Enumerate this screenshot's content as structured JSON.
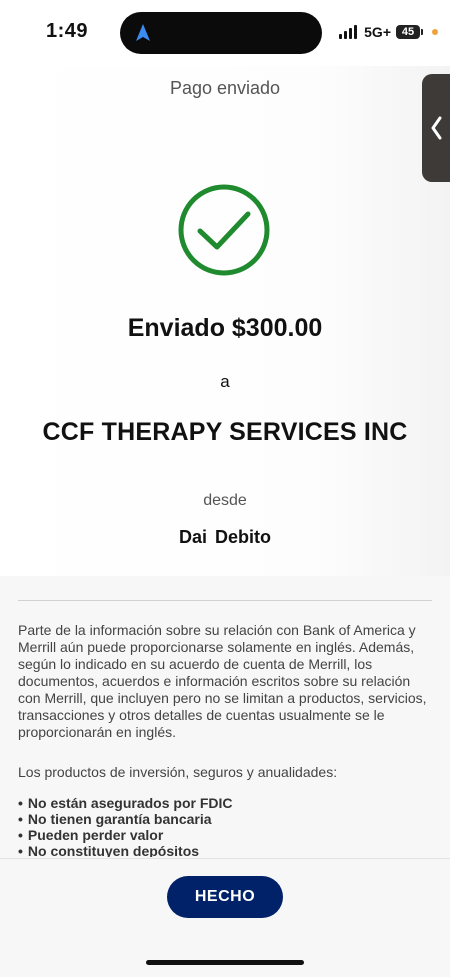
{
  "status_bar": {
    "time": "1:49",
    "network": "5G+",
    "battery": "45",
    "icons": [
      "navigation-arrow-icon",
      "signal-icon",
      "battery-icon"
    ]
  },
  "header": {
    "title": "Pago enviado"
  },
  "confirmation": {
    "icon": "checkmark-circle-icon",
    "sent_text": "Enviado $300.00",
    "to_label": "a",
    "recipient": "CCF THERAPY SERVICES INC",
    "from_label": "desde",
    "account": "Dai Debito"
  },
  "disclosure": {
    "paragraph": "Parte de la información sobre su relación con Bank of America y Merrill aún puede proporcionarse solamente en inglés. Además, según lo indicado en su acuerdo de cuenta de Merrill, los documentos, acuerdos e información escritos sobre su relación con Merrill, que incluyen pero no se limitan a productos, servicios, transacciones y otros detalles de cuentas usualmente se le proporcionarán en inglés.",
    "subhead": "Los productos de inversión, seguros y anualidades:",
    "bullets": [
      "No están asegurados por FDIC",
      "No tienen garantía bancaria",
      "Pueden perder valor",
      "No constituyen depósitos"
    ]
  },
  "footer": {
    "done_label": "HECHO"
  },
  "colors": {
    "success_green": "#1f8a2e",
    "button_navy": "#012169",
    "side_tab": "#3d3a38"
  }
}
